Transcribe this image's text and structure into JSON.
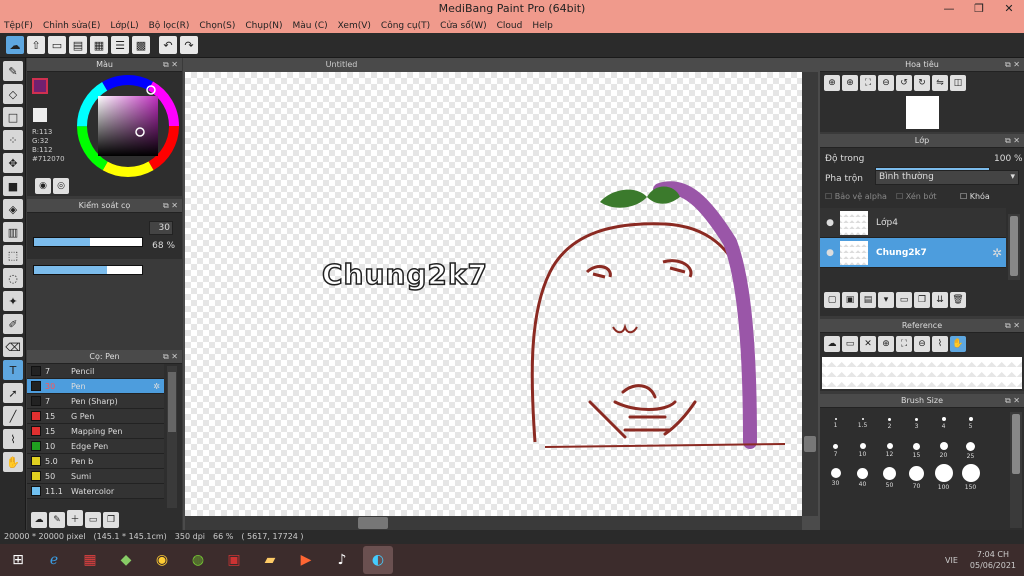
{
  "window": {
    "title": "MediBang Paint Pro (64bit)",
    "minimize": "—",
    "restore": "❐",
    "close": "✕"
  },
  "menu": [
    "Tệp(F)",
    "Chỉnh sửa(E)",
    "Lớp(L)",
    "Bộ lọc(R)",
    "Chọn(S)",
    "Chụp(N)",
    "Màu (C)",
    "Xem(V)",
    "Công cụ(T)",
    "Cửa sổ(W)",
    "Cloud",
    "Help"
  ],
  "color_panel": {
    "title": "Màu",
    "r": "R:113",
    "g": "G:32",
    "b": "B:112",
    "hex": "#712070",
    "fg_color": "#712070",
    "bg_color": "#ffffff"
  },
  "brush_control": {
    "title": "Kiểm soát cọ",
    "size_value": "30",
    "size_fill": 0.52,
    "opacity_value": "68 %",
    "opacity_fill": 0.68
  },
  "brush_panel": {
    "title": "Cọ: Pen",
    "items": [
      {
        "size": "7",
        "name": "Pencil",
        "color": "#222222"
      },
      {
        "size": "30",
        "name": "Pen",
        "color": "#222222",
        "selected": true
      },
      {
        "size": "7",
        "name": "Pen (Sharp)",
        "color": "#222222"
      },
      {
        "size": "15",
        "name": "G Pen",
        "color": "#e03030"
      },
      {
        "size": "15",
        "name": "Mapping Pen",
        "color": "#e03030"
      },
      {
        "size": "10",
        "name": "Edge Pen",
        "color": "#20a020"
      },
      {
        "size": "5.0",
        "name": "Pen b",
        "color": "#e0d020"
      },
      {
        "size": "50",
        "name": "Sumi",
        "color": "#e0d020"
      },
      {
        "size": "11.1",
        "name": "Watercolor",
        "color": "#70c0f0"
      }
    ]
  },
  "canvas": {
    "tab": "Untitled",
    "text": "Chung2k7"
  },
  "status": {
    "size": "20000 * 20000 pixel",
    "cm": "(145.1 * 145.1cm)",
    "dpi": "350 dpi",
    "zoom": "66 %",
    "coords": "( 5617, 17724 )"
  },
  "navigator": {
    "title": "Hoa tiêu"
  },
  "layers": {
    "title": "Lớp",
    "opacity_label": "Độ trong",
    "opacity_value": "100 %",
    "blend_label": "Pha trộn",
    "blend_value": "Bình thường",
    "protect_alpha": "Bảo vệ alpha",
    "clip": "Xén bớt",
    "lock": "Khóa",
    "items": [
      {
        "name": "Lớp4",
        "selected": false
      },
      {
        "name": "Chung2k7",
        "selected": true
      }
    ]
  },
  "reference": {
    "title": "Reference"
  },
  "brush_size": {
    "title": "Brush Size",
    "sizes": [
      "1",
      "1.5",
      "2",
      "3",
      "4",
      "5",
      "7",
      "10",
      "12",
      "15",
      "20",
      "25",
      "30",
      "40",
      "50",
      "70",
      "100",
      "150"
    ]
  },
  "taskbar": {
    "lang": "VIE",
    "time": "7:04 CH",
    "date": "05/06/2021"
  }
}
